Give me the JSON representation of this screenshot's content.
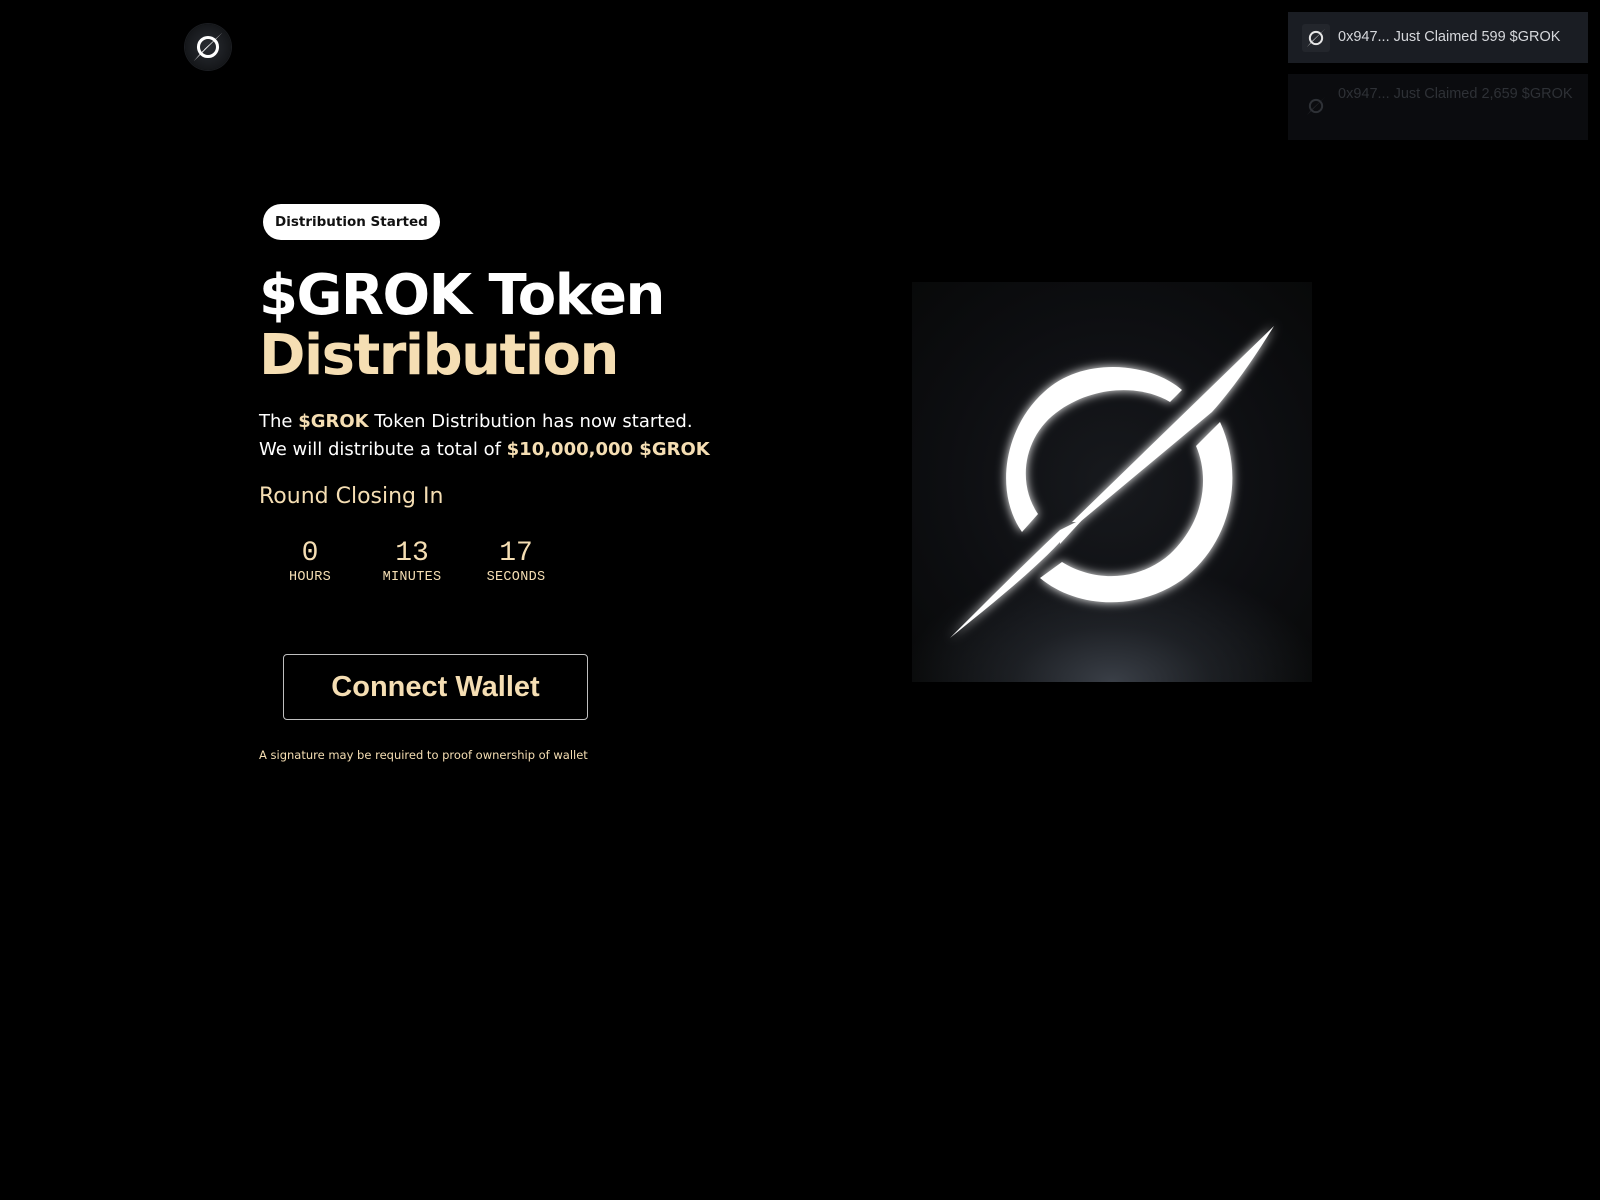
{
  "header": {
    "logo_icon": "grok-logo-icon"
  },
  "toasts": [
    {
      "icon": "grok-logo-icon",
      "text": "0x947... Just Claimed 599 $GROK"
    },
    {
      "icon": "grok-logo-icon",
      "text": "0x947... Just Claimed 2,659 $GROK"
    }
  ],
  "main": {
    "badge": "Distribution Started",
    "title_line1": "$GROK Token",
    "title_line2": "Distribution",
    "desc_line1_pre": "The ",
    "desc_line1_token": "$GROK",
    "desc_line1_post": " Token Distribution has now started.",
    "desc_line2_pre": "We will distribute a total of ",
    "desc_line2_amount": "$10,000,000 $GROK",
    "round_label": "Round Closing In",
    "countdown": {
      "hours_value": "0",
      "hours_label": "HOURS",
      "minutes_value": "13",
      "minutes_label": "MINUTES",
      "seconds_value": "17",
      "seconds_label": "SECONDS"
    },
    "connect_button": "Connect Wallet",
    "note": "A signature may be required to proof ownership of wallet"
  },
  "hero": {
    "image_icon": "grok-logo-icon"
  },
  "colors": {
    "background": "#000000",
    "accent": "#f5deb3",
    "text": "#ffffff"
  }
}
